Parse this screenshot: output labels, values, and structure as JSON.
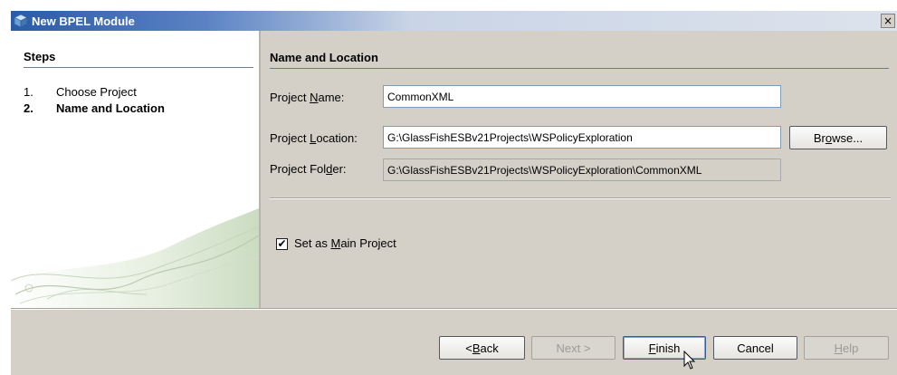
{
  "window": {
    "title": "New BPEL Module",
    "close_glyph": "×"
  },
  "steps": {
    "title": "Steps",
    "items": [
      {
        "num": "1.",
        "label": "Choose Project"
      },
      {
        "num": "2.",
        "label": "Name and Location"
      }
    ]
  },
  "panel": {
    "title": "Name and Location",
    "project_name": {
      "label_pre": "Project ",
      "label_u": "N",
      "label_post": "ame:",
      "value": "CommonXML"
    },
    "project_location": {
      "label_pre": "Project ",
      "label_u": "L",
      "label_post": "ocation:",
      "value": "G:\\GlassFishESBv21Projects\\WSPolicyExploration"
    },
    "project_folder": {
      "label_pre": "Project Fol",
      "label_u": "d",
      "label_post": "er:",
      "value": "G:\\GlassFishESBv21Projects\\WSPolicyExploration\\CommonXML"
    },
    "browse": {
      "pre": "Br",
      "u": "o",
      "post": "wse..."
    },
    "main_project": {
      "checked": true,
      "check_glyph": "✔",
      "pre": "Set as ",
      "u": "M",
      "post": "ain Project"
    }
  },
  "buttons": {
    "back": {
      "pre": "< ",
      "u": "B",
      "post": "ack"
    },
    "next": {
      "label": "Next >"
    },
    "finish": {
      "pre": "",
      "u": "F",
      "post": "inish"
    },
    "cancel": {
      "label": "Cancel"
    },
    "help": {
      "pre": "",
      "u": "H",
      "post": "elp"
    }
  },
  "colors": {
    "titlebar_start": "#2a5aa8",
    "dialog_bg": "#d4d0c8",
    "rule": "#6d7a8c"
  },
  "icons": [
    "app-cube-icon",
    "close-icon",
    "checkmark-icon",
    "mouse-pointer-icon",
    "wave-decoration"
  ]
}
